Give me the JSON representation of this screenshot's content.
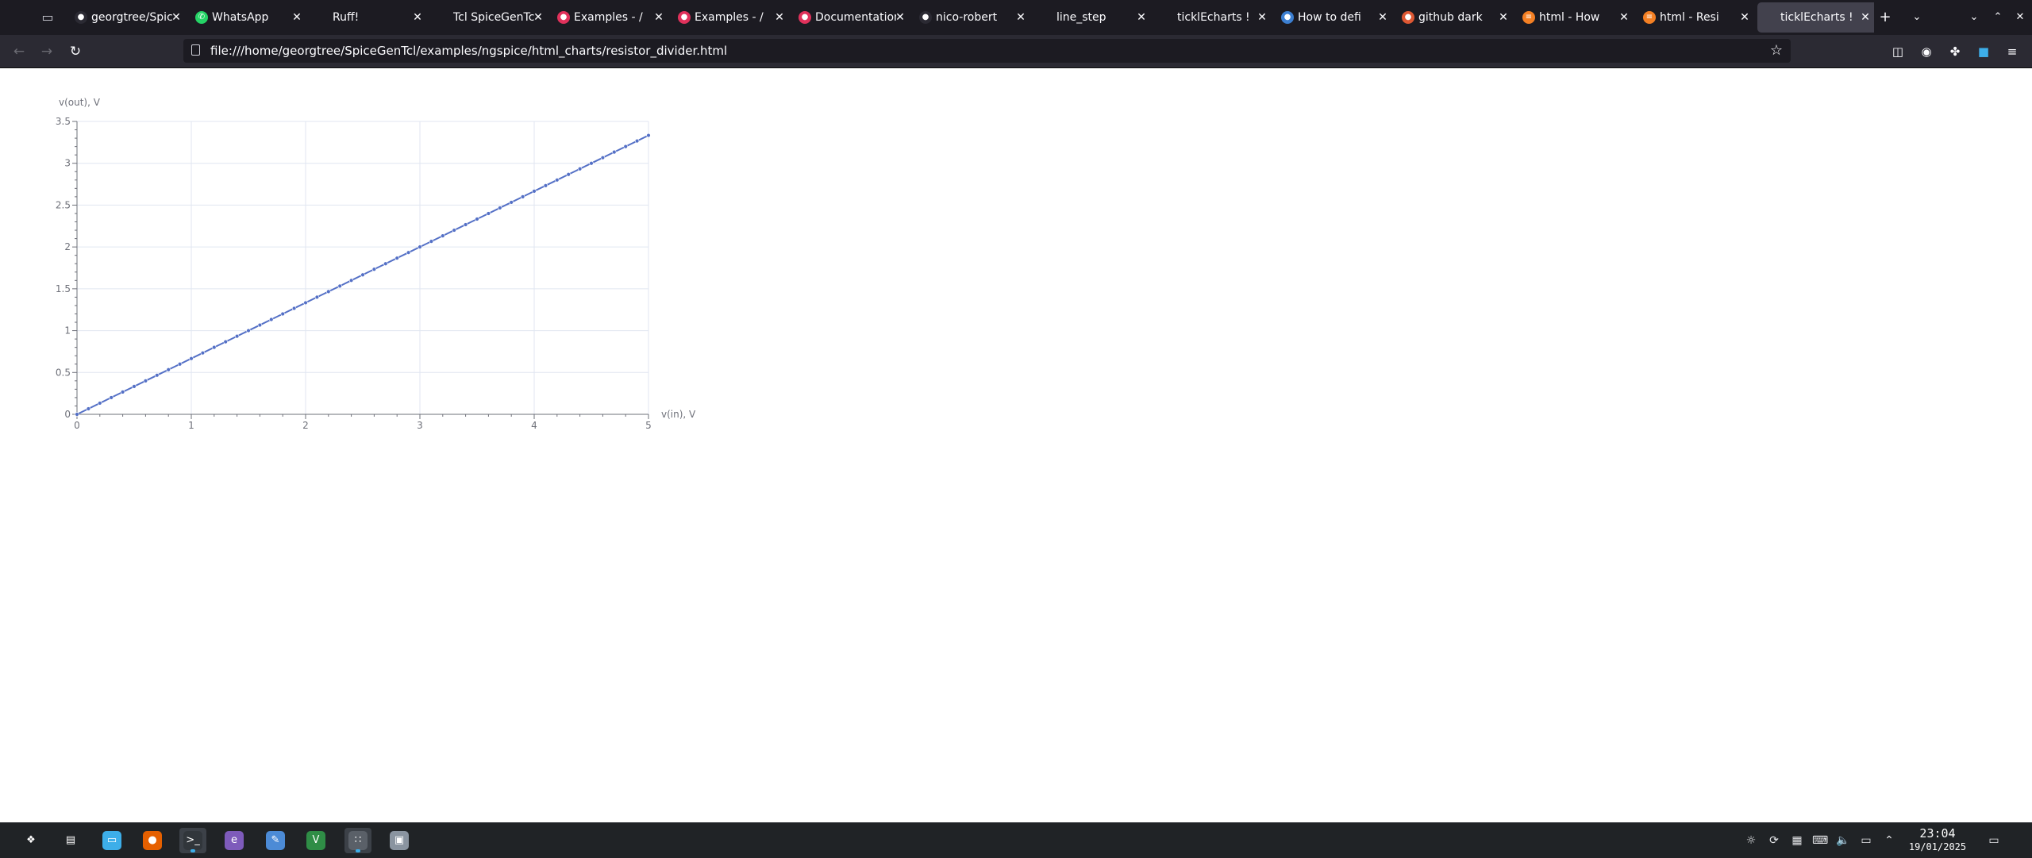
{
  "browser": {
    "tabs": [
      {
        "title": "georgtree/SpiceGenTcl",
        "favicon": "github-icon",
        "fav_color": "#2b2a33",
        "fav_glyph": "●"
      },
      {
        "title": "WhatsApp",
        "favicon": "whatsapp-icon",
        "fav_color": "#25d366",
        "fav_glyph": "✆"
      },
      {
        "title": "Ruff!",
        "favicon": "",
        "fav_color": "transparent",
        "fav_glyph": ""
      },
      {
        "title": "Tcl SpiceGenTcl",
        "favicon": "",
        "fav_color": "transparent",
        "fav_glyph": ""
      },
      {
        "title": "Examples - /",
        "favicon": "page-icon",
        "fav_color": "#e0315b",
        "fav_glyph": "●"
      },
      {
        "title": "Examples - /",
        "favicon": "page-icon",
        "fav_color": "#e0315b",
        "fav_glyph": "●"
      },
      {
        "title": "Documentation",
        "favicon": "page-icon",
        "fav_color": "#e0315b",
        "fav_glyph": "●"
      },
      {
        "title": "nico-robert",
        "favicon": "github-icon",
        "fav_color": "#2b2a33",
        "fav_glyph": "●"
      },
      {
        "title": "line_step",
        "favicon": "",
        "fav_color": "transparent",
        "fav_glyph": ""
      },
      {
        "title": "ticklEcharts !",
        "favicon": "",
        "fav_color": "transparent",
        "fav_glyph": ""
      },
      {
        "title": "How to defi",
        "favicon": "chat-icon",
        "fav_color": "#3c7fd1",
        "fav_glyph": "●"
      },
      {
        "title": "github dark",
        "favicon": "duckduckgo-icon",
        "fav_color": "#de5833",
        "fav_glyph": "●"
      },
      {
        "title": "html - How",
        "favicon": "stackoverflow-icon",
        "fav_color": "#f48024",
        "fav_glyph": "≡"
      },
      {
        "title": "html - Resi",
        "favicon": "stackoverflow-icon",
        "fav_color": "#f48024",
        "fav_glyph": "≡"
      },
      {
        "title": "ticklEcharts !",
        "favicon": "",
        "fav_color": "transparent",
        "fav_glyph": "",
        "active": true
      }
    ],
    "close_glyph": "✕",
    "new_tab_glyph": "+",
    "url": "file:///home/georgtree/SpiceGenTcl/examples/ngspice/html_charts/resistor_divider.html"
  },
  "chart_data": {
    "type": "line",
    "xlabel": "v(in), V",
    "ylabel": "v(out), V",
    "xlim": [
      0,
      5
    ],
    "ylim": [
      0,
      3.5
    ],
    "x_ticks": [
      0,
      1,
      2,
      3,
      4,
      5
    ],
    "y_ticks": [
      0,
      0.5,
      1,
      1.5,
      2,
      2.5,
      3,
      3.5
    ],
    "x_tick_labels": [
      "0",
      "1",
      "2",
      "3",
      "4",
      "5"
    ],
    "y_tick_labels": [
      "0",
      "0.5",
      "1",
      "1.5",
      "2",
      "2.5",
      "3",
      "3.5"
    ],
    "grid": true,
    "color": "#5470c6",
    "series": [
      {
        "x": [
          0,
          0.1,
          0.2,
          0.3,
          0.4,
          0.5,
          0.6,
          0.7,
          0.8,
          0.9,
          1.0,
          1.1,
          1.2,
          1.3,
          1.4,
          1.5,
          1.6,
          1.7,
          1.8,
          1.9,
          2.0,
          2.1,
          2.2,
          2.3,
          2.4,
          2.5,
          2.6,
          2.7,
          2.8,
          2.9,
          3.0,
          3.1,
          3.2,
          3.3,
          3.4,
          3.5,
          3.6,
          3.7,
          3.8,
          3.9,
          4.0,
          4.1,
          4.2,
          4.3,
          4.4,
          4.5,
          4.6,
          4.7,
          4.8,
          4.9,
          5.0
        ],
        "y": [
          0,
          0.0667,
          0.1333,
          0.2,
          0.2667,
          0.3333,
          0.4,
          0.4667,
          0.5333,
          0.6,
          0.6667,
          0.7333,
          0.8,
          0.8667,
          0.9333,
          1.0,
          1.0667,
          1.1333,
          1.2,
          1.2667,
          1.3333,
          1.4,
          1.4667,
          1.5333,
          1.6,
          1.6667,
          1.7333,
          1.8,
          1.8667,
          1.9333,
          2.0,
          2.0667,
          2.1333,
          2.2,
          2.2667,
          2.3333,
          2.4,
          2.4667,
          2.5333,
          2.6,
          2.6667,
          2.7333,
          2.8,
          2.8667,
          2.9333,
          3.0,
          3.0667,
          3.1333,
          3.2,
          3.2667,
          3.3333
        ]
      }
    ]
  },
  "taskbar": {
    "apps": [
      {
        "name": "app-launcher-icon",
        "color": "transparent",
        "glyph": "❖"
      },
      {
        "name": "pager-icon",
        "color": "transparent",
        "glyph": "▤"
      },
      {
        "name": "file-manager-icon",
        "color": "#3daee9",
        "glyph": "▭"
      },
      {
        "name": "firefox-icon",
        "color": "#e66000",
        "glyph": "●"
      },
      {
        "name": "terminal-icon",
        "color": "#31363b",
        "glyph": ">_"
      },
      {
        "name": "emacs-icon",
        "color": "#7e5bbb",
        "glyph": "e"
      },
      {
        "name": "graphics-app-icon",
        "color": "#4c8bd6",
        "glyph": "✎"
      },
      {
        "name": "vim-icon",
        "color": "#2f8d46",
        "glyph": "V"
      },
      {
        "name": "tcl-app-icon",
        "color": "#5a6068",
        "glyph": "∷"
      },
      {
        "name": "screen-app-icon",
        "color": "#8a94a0",
        "glyph": "▣"
      }
    ],
    "tray_icons": [
      "notifications-icon",
      "update-icon",
      "clipboard-icon",
      "keyboard-icon",
      "volume-icon",
      "display-icon",
      "expand-tray-icon"
    ],
    "time": "23:04",
    "date": "19/01/2025"
  }
}
